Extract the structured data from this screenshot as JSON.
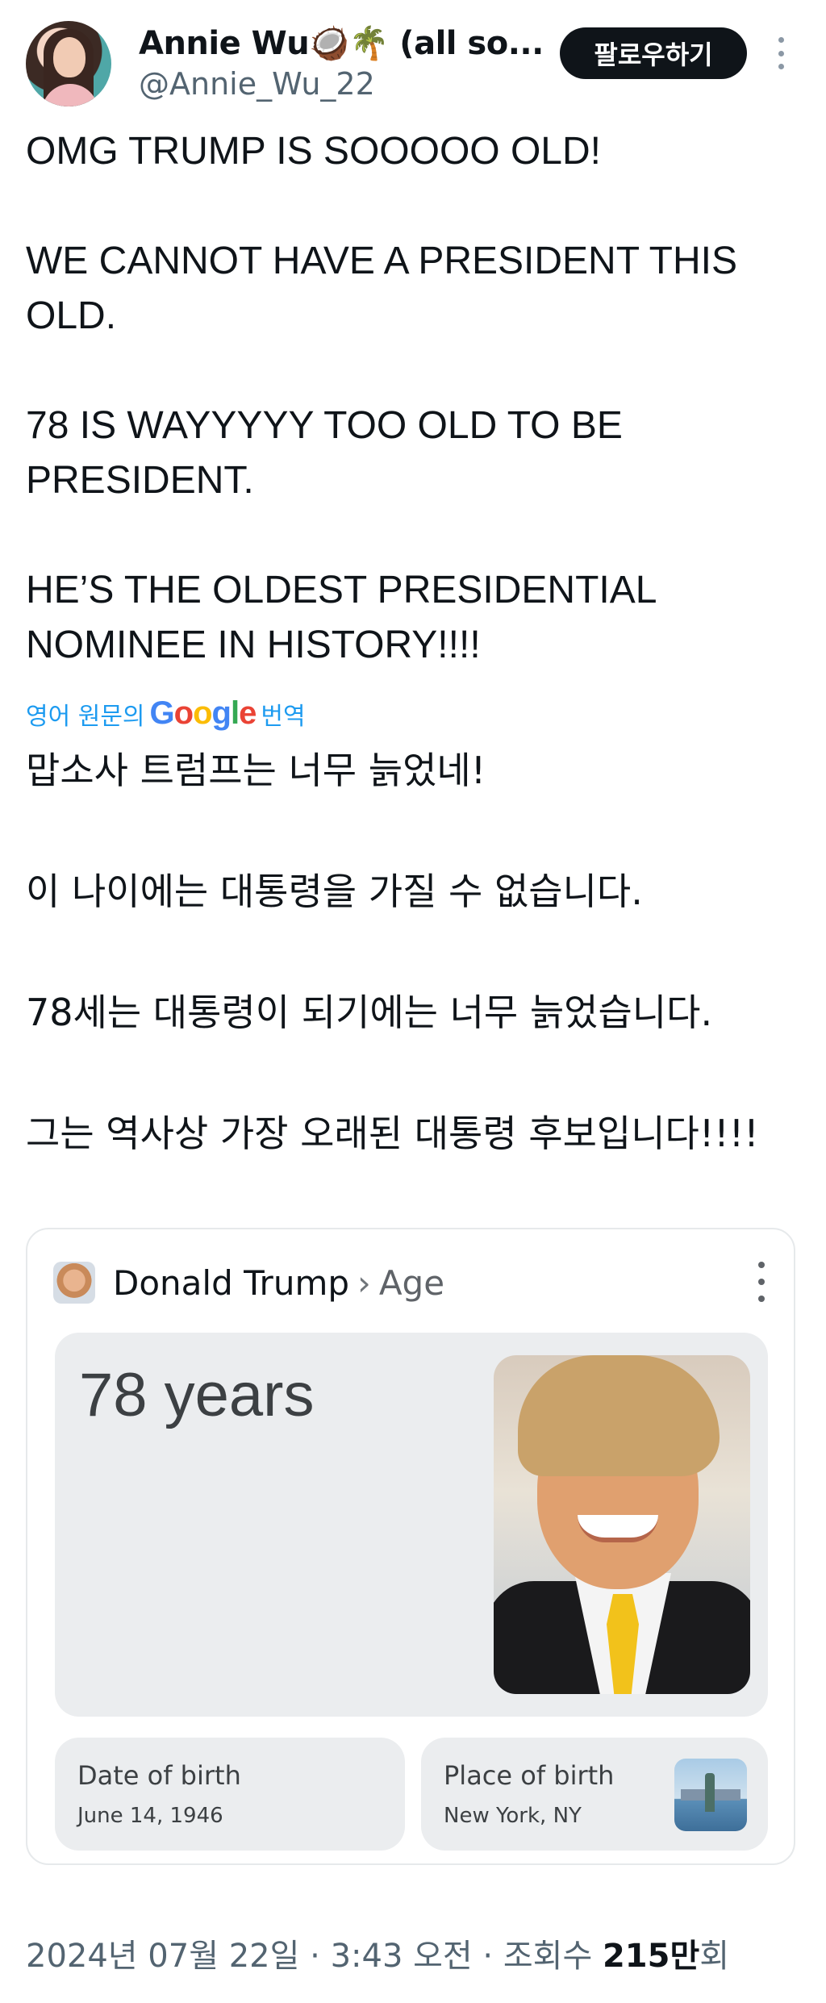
{
  "tweet": {
    "author": {
      "display_name": "Annie Wu🥥🌴 (all so...",
      "handle": "@Annie_Wu_22"
    },
    "follow_label": "팔로우하기",
    "text_lines": [
      "OMG TRUMP IS SOOOOO OLD!",
      "WE CANNOT HAVE A PRESIDENT THIS",
      "OLD.",
      "78 IS WAYYYYY TOO OLD TO BE",
      "PRESIDENT.",
      "HE’S THE OLDEST PRESIDENTIAL",
      "NOMINEE IN HISTORY!!!!"
    ],
    "translation": {
      "prefix": "영어 원문의",
      "brand": "Google",
      "suffix": "번역",
      "lines": [
        "맙소사 트럼프는 너무 늙었네!",
        "이 나이에는 대통령을 가질 수 없습니다.",
        "78세는 대통령이 되기에는 너무 늙었습니다.",
        "그는 역사상 가장 오래된 대통령 후보입니다!!!!"
      ]
    },
    "card": {
      "entity": "Donald Trump",
      "separator": "›",
      "attribute": "Age",
      "age_value": "78 years",
      "dob_label": "Date of birth",
      "dob_value": "June 14, 1946",
      "pob_label": "Place of birth",
      "pob_value": "New York, NY"
    },
    "meta": {
      "timestamp": "2024년 07월 22일 · 3:43 오전 · 조회수 ",
      "views": "215만",
      "views_suffix": "회"
    }
  },
  "colors": {
    "link": "#1d9bf0",
    "follow_button_bg": "#0f1419",
    "card_panel_bg": "#ebedef",
    "muted_text": "#536471"
  },
  "icons": {
    "more": "more-vertical-icon",
    "card_more": "more-vertical-icon"
  }
}
